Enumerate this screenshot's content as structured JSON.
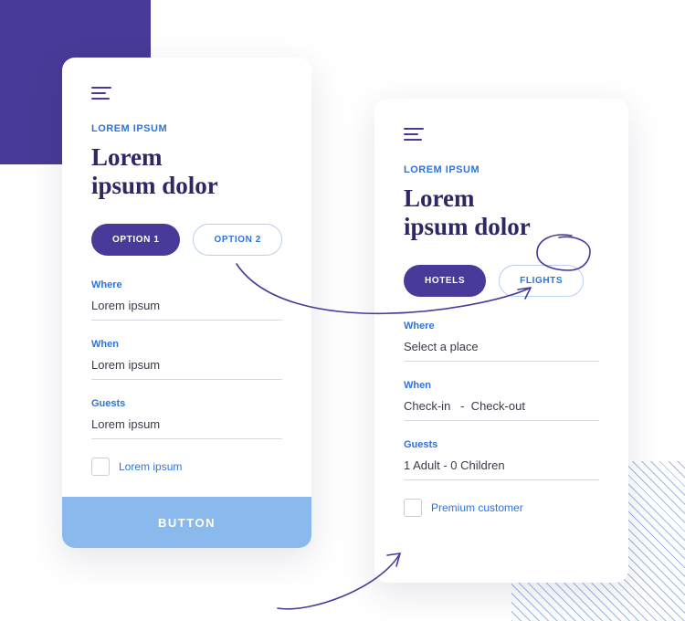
{
  "colors": {
    "brand_purple": "#483a98",
    "link_blue": "#2f73d9",
    "cta_blue": "#89b9ed"
  },
  "card_left": {
    "eyebrow": "LOREM IPSUM",
    "headline": "Lorem\nipsum dolor",
    "options": [
      {
        "label": "OPTION 1",
        "selected": true
      },
      {
        "label": "OPTION 2",
        "selected": false
      }
    ],
    "fields": {
      "where": {
        "label": "Where",
        "value": "Lorem ipsum"
      },
      "when": {
        "label": "When",
        "value": "Lorem ipsum"
      },
      "guests": {
        "label": "Guests",
        "value": "Lorem ipsum"
      }
    },
    "checkbox_label": "Lorem ipsum",
    "cta_label": "BUTTON"
  },
  "card_right": {
    "eyebrow": "LOREM IPSUM",
    "headline": "Lorem\nipsum dolor",
    "options": [
      {
        "label": "HOTELS",
        "selected": true
      },
      {
        "label": "FLIGHTS",
        "selected": false
      }
    ],
    "fields": {
      "where": {
        "label": "Where",
        "placeholder": "Select a place"
      },
      "when": {
        "label": "When",
        "placeholder": "Check-in   -  Check-out"
      },
      "guests": {
        "label": "Guests",
        "value": "1 Adult - 0 Children"
      }
    },
    "checkbox_label": "Premium customer"
  }
}
